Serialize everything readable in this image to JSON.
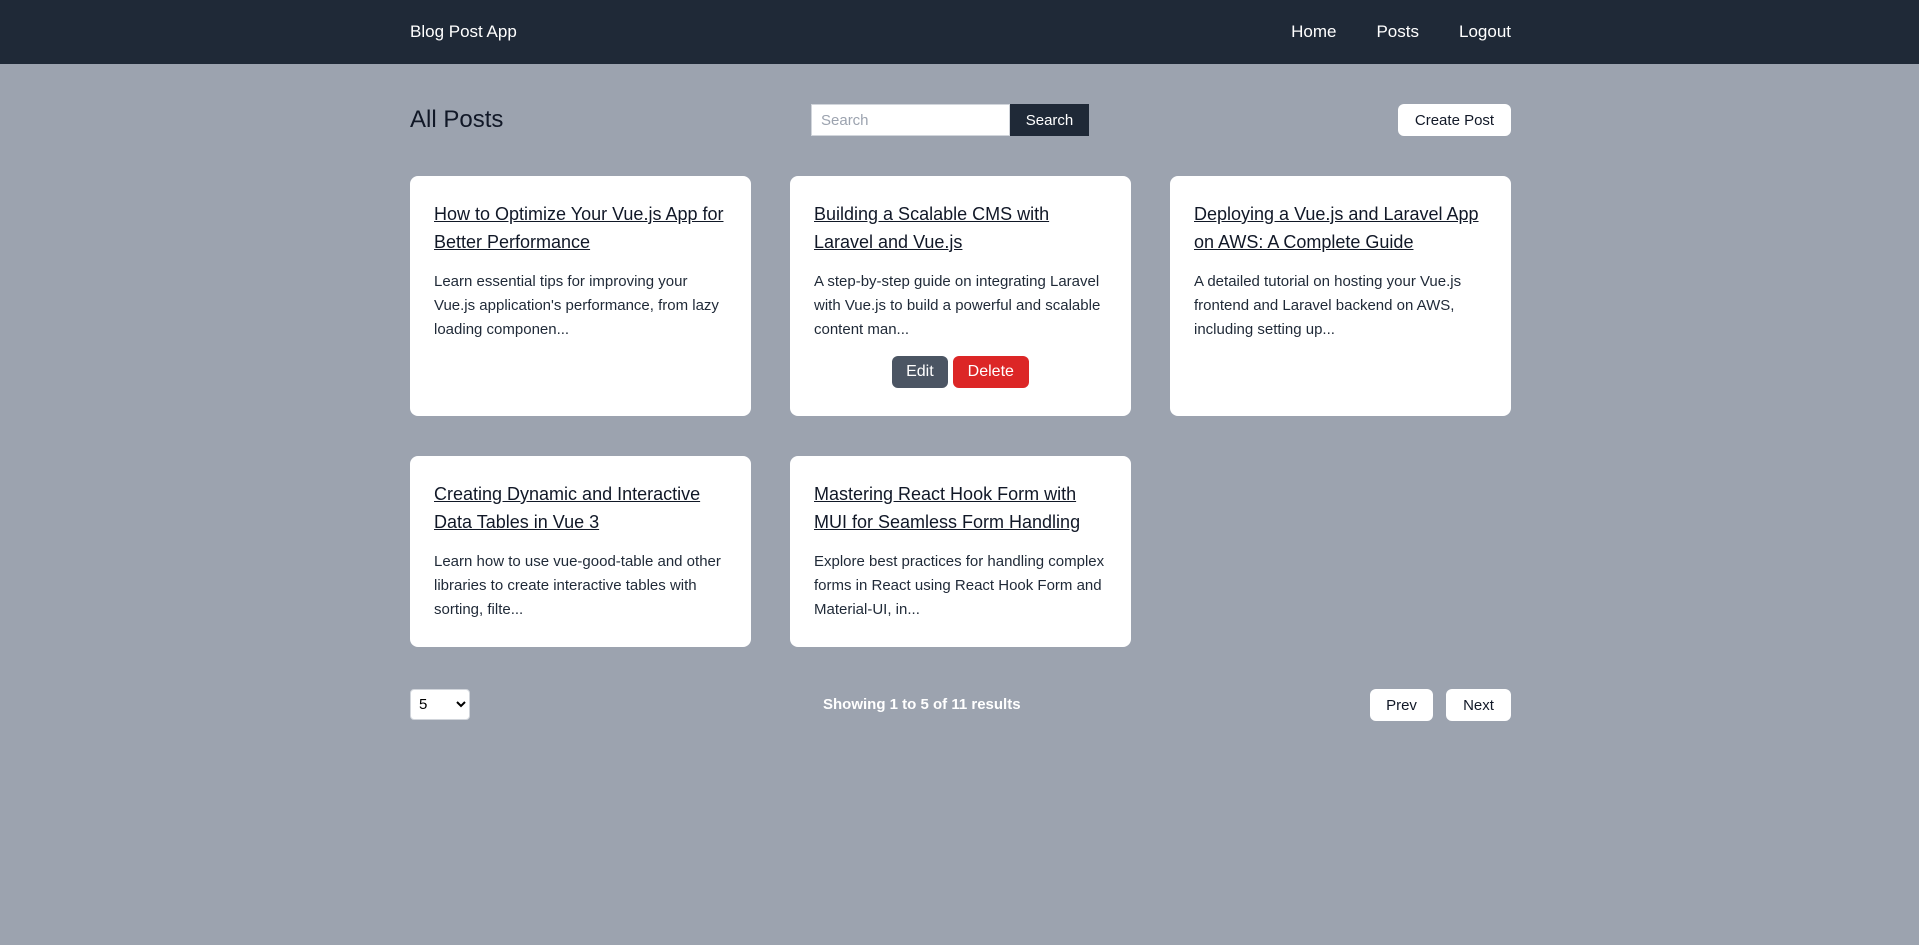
{
  "navbar": {
    "brand": "Blog Post App",
    "links": [
      "Home",
      "Posts",
      "Logout"
    ]
  },
  "header": {
    "title": "All Posts",
    "search_placeholder": "Search",
    "search_value": "",
    "search_button": "Search",
    "create_button": "Create Post"
  },
  "posts": [
    {
      "title": "How to Optimize Your Vue.js App for Better Performance",
      "excerpt": "Learn essential tips for improving your Vue.js application's performance, from lazy loading componen..."
    },
    {
      "title": "Building a Scalable CMS with Laravel and Vue.js",
      "excerpt": "A step-by-step guide on integrating Laravel with Vue.js to build a powerful and scalable content man...",
      "actions": {
        "edit": "Edit",
        "delete": "Delete"
      }
    },
    {
      "title": "Deploying a Vue.js and Laravel App on AWS: A Complete Guide",
      "excerpt": "A detailed tutorial on hosting your Vue.js frontend and Laravel backend on AWS, including setting up..."
    },
    {
      "title": "Creating Dynamic and Interactive Data Tables in Vue 3",
      "excerpt": "Learn how to use vue-good-table and other libraries to create interactive tables with sorting, filte..."
    },
    {
      "title": "Mastering React Hook Form with MUI for Seamless Form Handling",
      "excerpt": "Explore best practices for handling complex forms in React using React Hook Form and Material-UI, in..."
    }
  ],
  "pagination": {
    "per_page": "5",
    "results_text": "Showing 1 to 5 of 11 results",
    "prev": "Prev",
    "next": "Next"
  },
  "colors": {
    "navbar": "#1f2937",
    "background": "#9ca3af",
    "edit_button": "#4b5563",
    "delete_button": "#dc2626"
  }
}
